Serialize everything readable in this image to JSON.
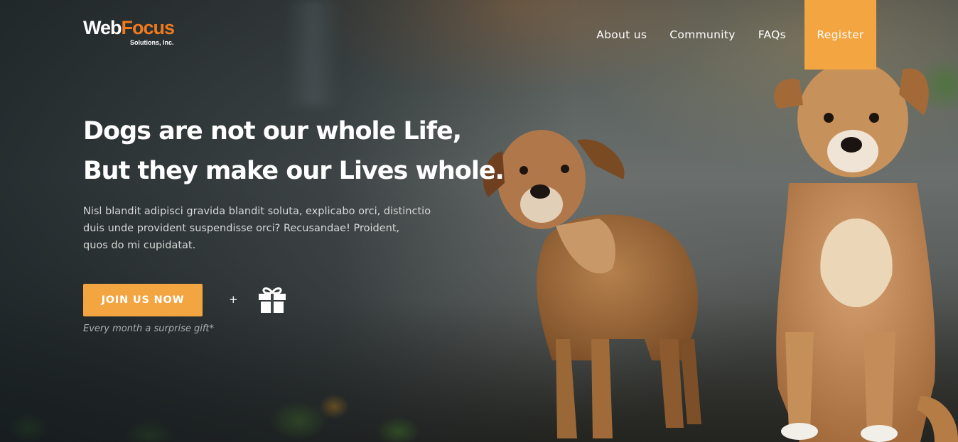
{
  "logo": {
    "brand_web": "Web",
    "brand_focus": "Focus",
    "subtitle": "Solutions, Inc."
  },
  "nav": {
    "items": [
      {
        "label": "About us"
      },
      {
        "label": "Community"
      },
      {
        "label": "FAQs"
      }
    ],
    "register_label": "Register"
  },
  "hero": {
    "headline_line1": "Dogs are not our whole Life,",
    "headline_line2": "But they make our Lives whole.",
    "lead_line1": "Nisl blandit adipisci gravida blandit soluta, explicabo orci, distinctio",
    "lead_line2": "duis unde provident suspendisse orci? Recusandae! Proident,",
    "lead_line3": "quos do mi cupidatat.",
    "cta_label": "JOIN US NOW",
    "plus_symbol": "+",
    "gift_icon": "gift-icon",
    "note": "Every month a surprise gift*"
  },
  "colors": {
    "accent": "#f2a540",
    "logo_orange": "#f07a1c",
    "text_light": "#ffffff"
  }
}
